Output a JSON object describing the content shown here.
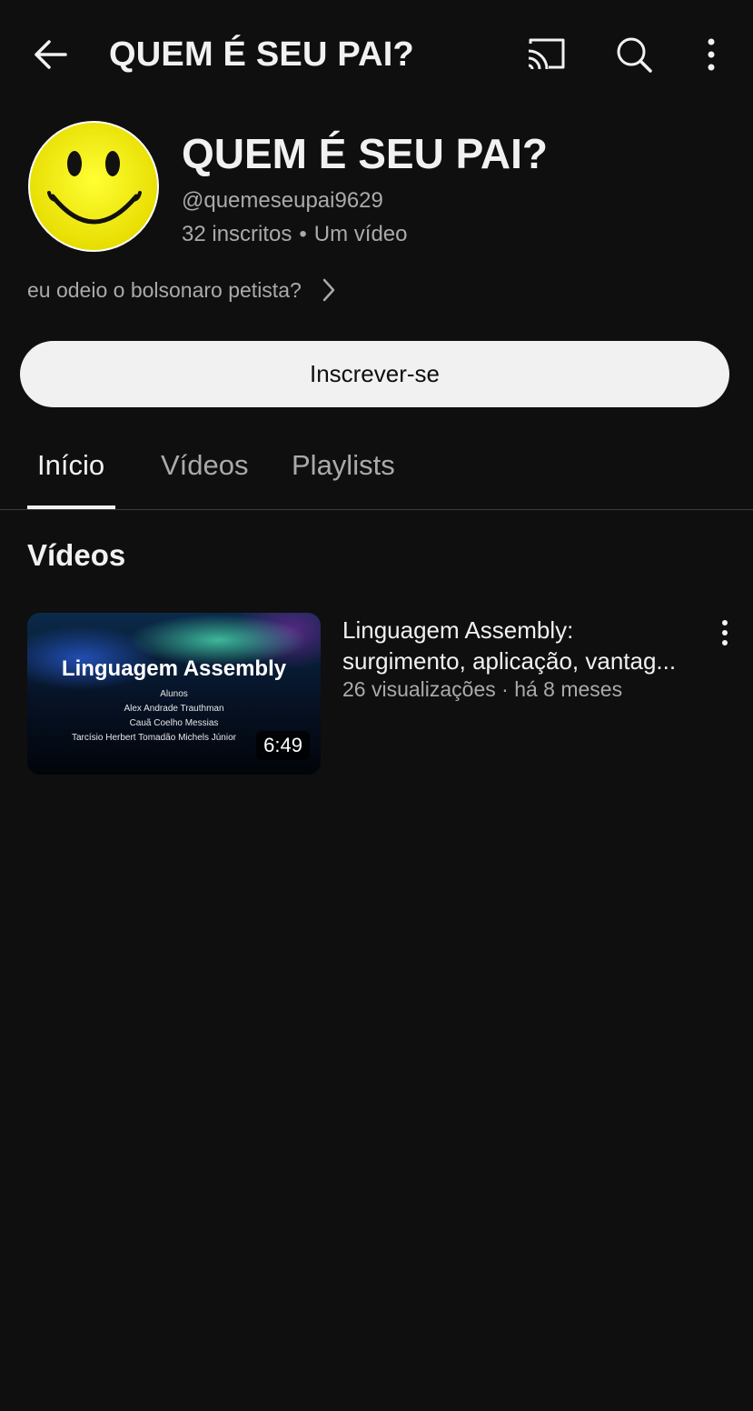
{
  "header": {
    "title": "QUEM É SEU PAI?",
    "icons": [
      "arrow-back-icon",
      "cast-icon",
      "search-icon",
      "more-vert-icon"
    ]
  },
  "channel": {
    "name": "QUEM É SEU PAI?",
    "handle": "@quemeseupai9629",
    "subscribers": "32 inscritos",
    "separator": "•",
    "video_count": "Um vídeo",
    "description": "eu odeio o bolsonaro petista?",
    "subscribe_label": "Inscrever-se"
  },
  "tabs": [
    {
      "label": "Início",
      "active": true
    },
    {
      "label": "Vídeos",
      "active": false
    },
    {
      "label": "Playlists",
      "active": false
    }
  ],
  "section": {
    "title": "Vídeos"
  },
  "videos": [
    {
      "title_line1": "Linguagem Assembly:",
      "title_line2": "surgimento, aplicação, vantag...",
      "meta": "26 visualizações · há 8 meses",
      "duration": "6:49",
      "thumbnail": {
        "title": "Linguagem Assembly",
        "line1": "Alunos",
        "line2": "Alex Andrade Trauthman",
        "line3": "Cauã Coelho Messias",
        "line4": "Tarcísio Herbert Tomadão Michels Júnior"
      }
    }
  ],
  "colors": {
    "background": "#0f0f0f",
    "text_primary": "#f1f1f1",
    "text_secondary": "#aaaaaa",
    "subscribe_bg": "#f1f1f1",
    "avatar_yellow": "#f2ec00"
  }
}
